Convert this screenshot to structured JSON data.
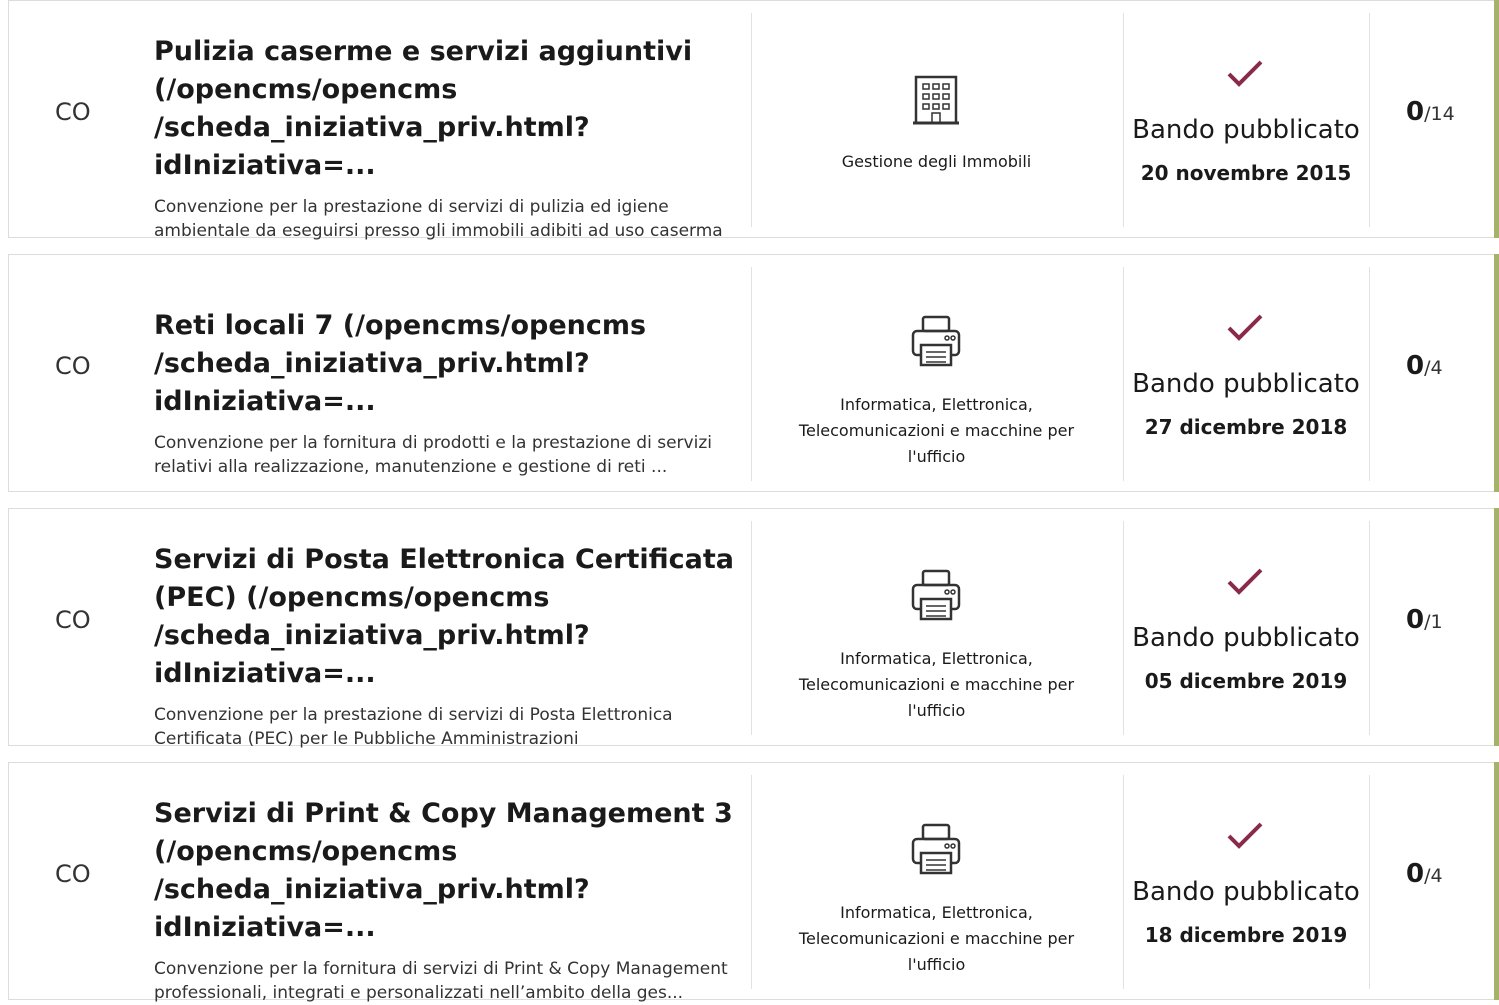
{
  "rows": [
    {
      "type_code": "CO",
      "title": "Pulizia caserme e servizi aggiuntivi\n(/opencms/opencms\n/scheda_iniziativa_priv.html?idIniziativa=...",
      "description": "Convenzione per la prestazione di servizi di pulizia ed igiene ambientale da eseguirsi presso gli immobili adibiti ad uso caserma",
      "category_icon": "building-icon",
      "category": "Gestione degli Immobili",
      "status": "Bando pubblicato",
      "date": "20 novembre 2015",
      "count": "0",
      "total": "/14"
    },
    {
      "type_code": "CO",
      "title": "Reti locali 7 (/opencms/opencms\n/scheda_iniziativa_priv.html?idIniziativa=...",
      "description": "Convenzione per la fornitura di prodotti e la prestazione di servizi relativi alla realizzazione, manutenzione e gestione di reti ...",
      "category_icon": "printer-icon",
      "category": "Informatica, Elettronica, Telecomunicazioni e macchine per l'ufficio",
      "status": "Bando pubblicato",
      "date": "27 dicembre 2018",
      "count": "0",
      "total": "/4"
    },
    {
      "type_code": "CO",
      "title": "Servizi di Posta Elettronica Certificata\n(PEC) (/opencms/opencms\n/scheda_iniziativa_priv.html?idIniziativa=...",
      "description": "Convenzione per la prestazione di servizi di Posta Elettronica Certificata (PEC) per le Pubbliche Amministrazioni",
      "category_icon": "printer-icon",
      "category": "Informatica, Elettronica, Telecomunicazioni e macchine per l'ufficio",
      "status": "Bando pubblicato",
      "date": "05 dicembre 2019",
      "count": "0",
      "total": "/1"
    },
    {
      "type_code": "CO",
      "title": "Servizi di Print & Copy Management 3\n(/opencms/opencms\n/scheda_iniziativa_priv.html?idIniziativa=...",
      "description": "Convenzione per la fornitura di servizi di Print & Copy Management professionali, integrati e personalizzati nell’ambito della ges...",
      "category_icon": "printer-icon",
      "category": "Informatica, Elettronica, Telecomunicazioni e macchine per l'ufficio",
      "status": "Bando pubblicato",
      "date": "18 dicembre 2019",
      "count": "0",
      "total": "/4"
    }
  ],
  "colors": {
    "accent_bar": "#a4b26a",
    "check": "#8a2a4a"
  }
}
